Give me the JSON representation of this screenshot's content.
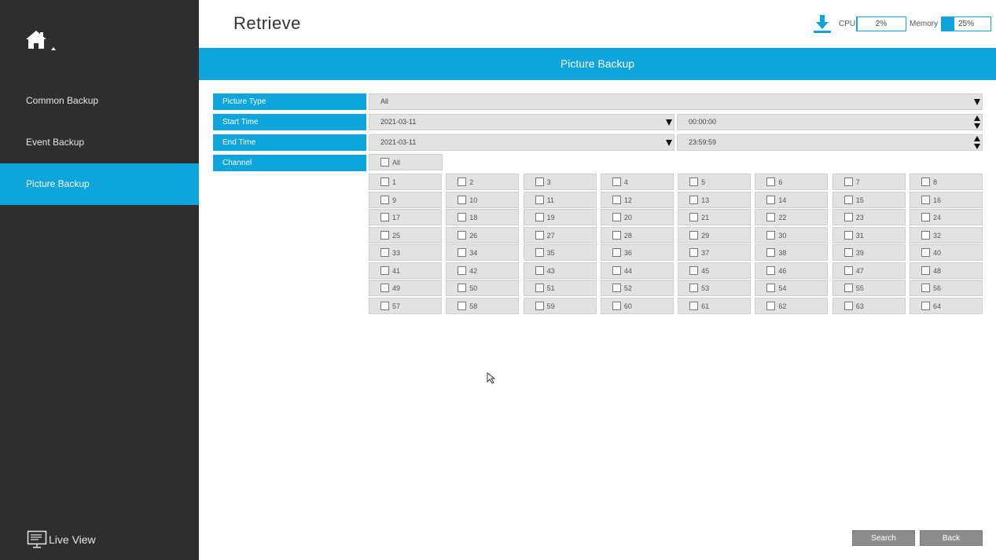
{
  "sidebar": {
    "items": [
      {
        "label": "Common Backup",
        "active": false
      },
      {
        "label": "Event Backup",
        "active": false
      },
      {
        "label": "Picture Backup",
        "active": true
      }
    ],
    "live_view_label": "Live View"
  },
  "header": {
    "title": "Retrieve",
    "cpu_label": "CPU",
    "cpu_value": "2%",
    "cpu_fraction": 0.02,
    "memory_label": "Memory",
    "memory_value": "25%",
    "memory_fraction": 0.25
  },
  "panel": {
    "title": "Picture Backup"
  },
  "form": {
    "picture_type_label": "Picture Type",
    "picture_type_value": "All",
    "start_time_label": "Start Time",
    "start_date": "2021-03-11",
    "start_time": "00:00:00",
    "end_time_label": "End Time",
    "end_date": "2021-03-11",
    "end_time": "23:59:59",
    "channel_label": "Channel",
    "channel_all_label": "All",
    "channels": [
      "1",
      "2",
      "3",
      "4",
      "5",
      "6",
      "7",
      "8",
      "9",
      "10",
      "11",
      "12",
      "13",
      "14",
      "15",
      "16",
      "17",
      "18",
      "19",
      "20",
      "21",
      "22",
      "23",
      "24",
      "25",
      "26",
      "27",
      "28",
      "29",
      "30",
      "31",
      "32",
      "33",
      "34",
      "35",
      "36",
      "37",
      "38",
      "39",
      "40",
      "41",
      "42",
      "43",
      "44",
      "45",
      "46",
      "47",
      "48",
      "49",
      "50",
      "51",
      "52",
      "53",
      "54",
      "55",
      "56",
      "57",
      "58",
      "59",
      "60",
      "61",
      "62",
      "63",
      "64"
    ]
  },
  "buttons": {
    "search": "Search",
    "back": "Back"
  },
  "colors": {
    "accent": "#0ea5dd",
    "sidebar_bg": "#2e2e2e",
    "field_bg": "#e2e2e2",
    "button_bg": "#8c8c8c"
  }
}
